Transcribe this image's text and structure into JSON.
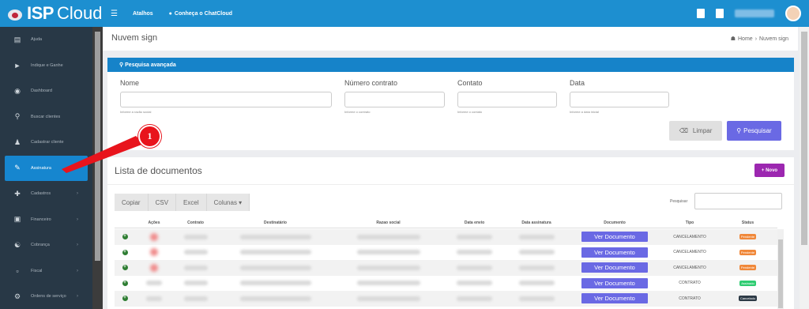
{
  "app": {
    "logo_bold": "ISP",
    "logo_light": "Cloud"
  },
  "topbar": {
    "atalhos": "Atalhos",
    "chatcloud": "Conheça o ChatCloud"
  },
  "sidebar": {
    "items": [
      {
        "label": "Ajuda",
        "icon": "book-icon"
      },
      {
        "label": "Indique e Ganhe",
        "icon": "megaphone-icon"
      },
      {
        "label": "Dashboard",
        "icon": "dashboard-icon"
      },
      {
        "label": "Buscar clientes",
        "icon": "search-icon"
      },
      {
        "label": "Cadastrar cliente",
        "icon": "user-plus-icon"
      },
      {
        "label": "Assinatura",
        "icon": "pen-icon"
      },
      {
        "label": "Cadastros",
        "icon": "plus-icon"
      },
      {
        "label": "Financeiro",
        "icon": "money-icon"
      },
      {
        "label": "Cobrança",
        "icon": "handshake-icon"
      },
      {
        "label": "Fiscal",
        "icon": "document-icon"
      },
      {
        "label": "Ordens de serviço",
        "icon": "wrench-icon"
      }
    ]
  },
  "page": {
    "title": "Nuvem sign",
    "breadcrumb_home": "Home",
    "breadcrumb_sep": "›",
    "breadcrumb_current": "Nuvem sign"
  },
  "search": {
    "header": "Pesquisa avançada",
    "fields": [
      {
        "label": "Nome",
        "hint": "Informe a razão social"
      },
      {
        "label": "Número contrato",
        "hint": "Informe o contrato"
      },
      {
        "label": "Contato",
        "hint": "Informe o contato"
      },
      {
        "label": "Data",
        "hint": "Informe a data inicial"
      }
    ],
    "clear_label": "Limpar",
    "search_label": "Pesquisar"
  },
  "docs": {
    "title": "Lista de documentos",
    "new_label": "Novo",
    "export_buttons": [
      "Copiar",
      "CSV",
      "Excel",
      "Colunas"
    ],
    "search_label": "Pesquisar",
    "columns": [
      "Ações",
      "Contrato",
      "Destinatário",
      "Razao social",
      "Data envio",
      "Data assinatura",
      "Documento",
      "Tipo",
      "Status"
    ],
    "rows": [
      {
        "doc": "Ver Documento",
        "tipo": "CANCELAMENTO",
        "status": "Pendente",
        "status_color": "#f0883a"
      },
      {
        "doc": "Ver Documento",
        "tipo": "CANCELAMENTO",
        "status": "Pendente",
        "status_color": "#f0883a"
      },
      {
        "doc": "Ver Documento",
        "tipo": "CANCELAMENTO",
        "status": "Pendente",
        "status_color": "#f0883a"
      },
      {
        "doc": "Ver Documento",
        "tipo": "CONTRATO",
        "status": "Assinado",
        "status_color": "#2ecc71"
      },
      {
        "doc": "Ver Documento",
        "tipo": "CONTRATO",
        "status": "Cancelado",
        "status_color": "#2d3a46"
      }
    ]
  },
  "annotation": {
    "step": "1"
  },
  "colors": {
    "topbar": "#1d8fd0",
    "sidebar": "#283846",
    "active": "#1686cf",
    "primary_button": "#6a69e4",
    "novo_button": "#9c27b0",
    "callout": "#e8141c"
  }
}
